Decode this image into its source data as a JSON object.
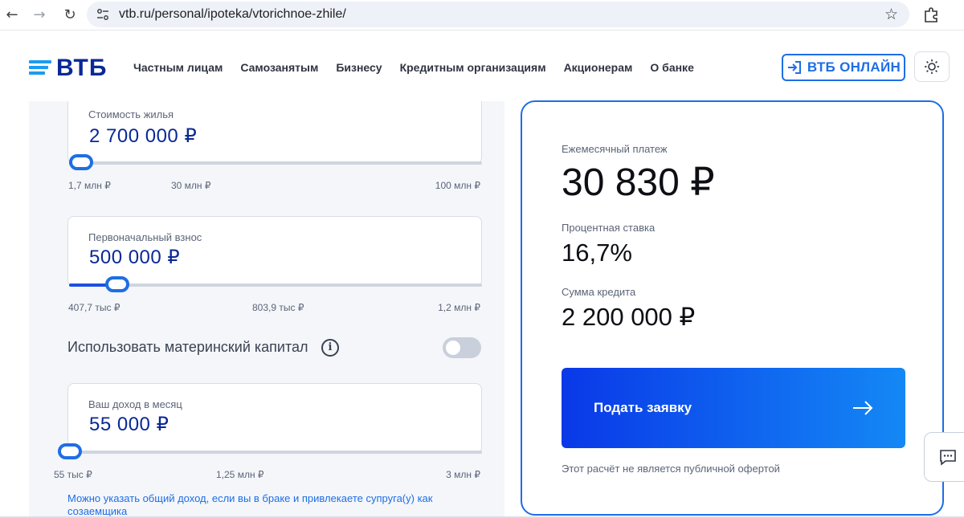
{
  "browser": {
    "url": "vtb.ru/personal/ipoteka/vtorichnoe-zhile/"
  },
  "header": {
    "logo": "ВТБ",
    "nav": [
      "Частным лицам",
      "Самозанятым",
      "Бизнесу",
      "Кредитным организациям",
      "Акционерам",
      "О банке"
    ],
    "online_button": "ВТБ ОНЛАЙН"
  },
  "calculator": {
    "price": {
      "label": "Стоимость жилья",
      "value": "2 700 000 ₽",
      "ticks": [
        "1,7 млн ₽",
        "30 млн ₽",
        "100 млн ₽"
      ],
      "slider_fraction": 0.01
    },
    "down_payment": {
      "label": "Первоначальный взнос",
      "value": "500 000 ₽",
      "ticks": [
        "407,7 тыс ₽",
        "803,9 тыс ₽",
        "1,2 млн ₽"
      ],
      "slider_fraction": 0.117
    },
    "maternity_capital": {
      "label": "Использовать материнский капитал",
      "enabled": false
    },
    "income": {
      "label": "Ваш доход в месяц",
      "value": "55 000 ₽",
      "ticks": [
        "55 тыс ₽",
        "1,25 млн ₽",
        "3 млн ₽"
      ],
      "slider_fraction": 0.0
    },
    "hint": "Можно указать общий доход, если вы в браке и привлекаете супруга(у) как созаемщика"
  },
  "result": {
    "monthly_label": "Ежемесячный платеж",
    "monthly_value": "30 830 ₽",
    "rate_label": "Процентная ставка",
    "rate_value": "16,7%",
    "loan_label": "Сумма кредита",
    "loan_value": "2 200 000 ₽",
    "submit_label": "Подать заявку",
    "disclaimer": "Этот расчёт не является публичной офертой"
  },
  "colors": {
    "brand_blue": "#0a2896",
    "accent": "#1e6ee6",
    "logo_blue": "#1d9bf0"
  }
}
